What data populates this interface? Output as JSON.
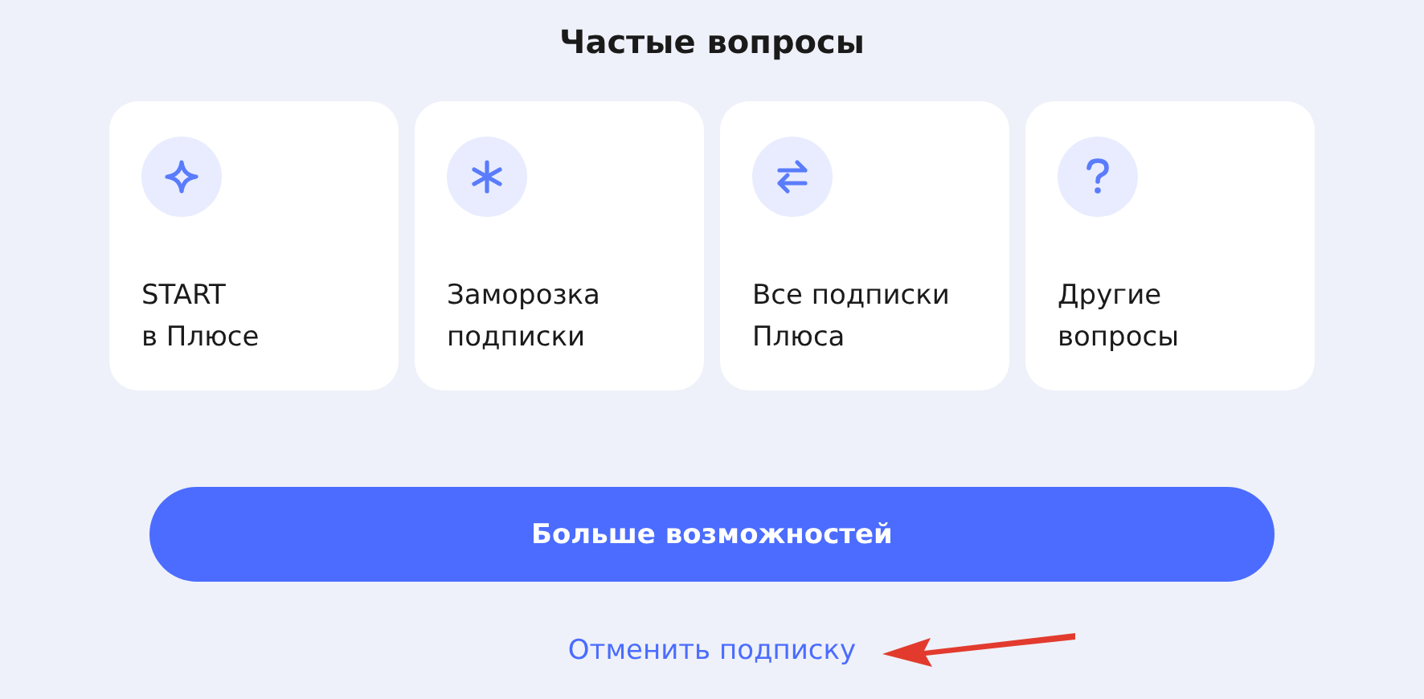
{
  "title": "Частые вопросы",
  "cards": [
    {
      "kind": "sparkle",
      "lines": [
        "START",
        "в Плюсе"
      ]
    },
    {
      "kind": "asterisk",
      "lines": [
        "Заморозка",
        "подписки"
      ]
    },
    {
      "kind": "swap",
      "lines": [
        "Все подписки",
        "Плюса"
      ]
    },
    {
      "kind": "question",
      "lines": [
        "Другие",
        "вопросы"
      ]
    }
  ],
  "primary_button": "Больше возможностей",
  "cancel_link": "Отменить подписку",
  "annotation": {
    "kind": "arrow"
  }
}
